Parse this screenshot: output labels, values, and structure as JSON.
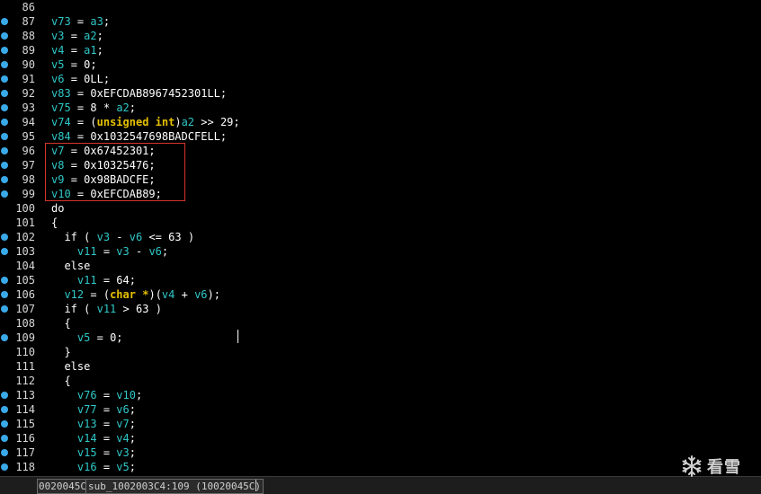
{
  "editor": {
    "lines": [
      {
        "num": "86",
        "bp": false,
        "code": ""
      },
      {
        "num": "87",
        "bp": true,
        "code": "v73 = a3;"
      },
      {
        "num": "88",
        "bp": true,
        "code": "v3 = a2;"
      },
      {
        "num": "89",
        "bp": true,
        "code": "v4 = a1;"
      },
      {
        "num": "90",
        "bp": true,
        "code": "v5 = 0;"
      },
      {
        "num": "91",
        "bp": true,
        "code": "v6 = 0LL;"
      },
      {
        "num": "92",
        "bp": true,
        "code": "v83 = 0xEFCDAB8967452301LL;"
      },
      {
        "num": "93",
        "bp": true,
        "code": "v75 = 8 * a2;"
      },
      {
        "num": "94",
        "bp": true,
        "code": "v74 = (unsigned int)a2 >> 29;"
      },
      {
        "num": "95",
        "bp": true,
        "code": "v84 = 0x1032547698BADCFELL;"
      },
      {
        "num": "96",
        "bp": true,
        "code": "v7 = 0x67452301;"
      },
      {
        "num": "97",
        "bp": true,
        "code": "v8 = 0x10325476;"
      },
      {
        "num": "98",
        "bp": true,
        "code": "v9 = 0x98BADCFE;"
      },
      {
        "num": "99",
        "bp": true,
        "code": "v10 = 0xEFCDAB89;"
      },
      {
        "num": "100",
        "bp": false,
        "code": "do"
      },
      {
        "num": "101",
        "bp": false,
        "code": "{"
      },
      {
        "num": "102",
        "bp": true,
        "code": "  if ( v3 - v6 <= 63 )"
      },
      {
        "num": "103",
        "bp": true,
        "code": "    v11 = v3 - v6;"
      },
      {
        "num": "104",
        "bp": false,
        "code": "  else"
      },
      {
        "num": "105",
        "bp": true,
        "code": "    v11 = 64;"
      },
      {
        "num": "106",
        "bp": true,
        "code": "  v12 = (char *)(v4 + v6);"
      },
      {
        "num": "107",
        "bp": true,
        "code": "  if ( v11 > 63 )"
      },
      {
        "num": "108",
        "bp": false,
        "code": "  {"
      },
      {
        "num": "109",
        "bp": true,
        "code": "    v5 = 0;"
      },
      {
        "num": "110",
        "bp": false,
        "code": "  }"
      },
      {
        "num": "111",
        "bp": false,
        "code": "  else"
      },
      {
        "num": "112",
        "bp": false,
        "code": "  {"
      },
      {
        "num": "113",
        "bp": true,
        "code": "    v76 = v10;"
      },
      {
        "num": "114",
        "bp": true,
        "code": "    v77 = v6;"
      },
      {
        "num": "115",
        "bp": true,
        "code": "    v13 = v7;"
      },
      {
        "num": "116",
        "bp": true,
        "code": "    v14 = v4;"
      },
      {
        "num": "117",
        "bp": true,
        "code": "    v15 = v3;"
      },
      {
        "num": "118",
        "bp": true,
        "code": "    v16 = v5;"
      }
    ]
  },
  "statusbar": {
    "address": "0020045C",
    "function_location": "sub_1002003C4:109 (10020045C)"
  },
  "watermark": {
    "text": "看雪",
    "icon": "snowflake-icon"
  },
  "colors": {
    "variable": "#30c8c8",
    "type_keyword": "#e6c000",
    "breakpoint_dot": "#3aa9e8",
    "highlight_box": "#d6352c"
  }
}
